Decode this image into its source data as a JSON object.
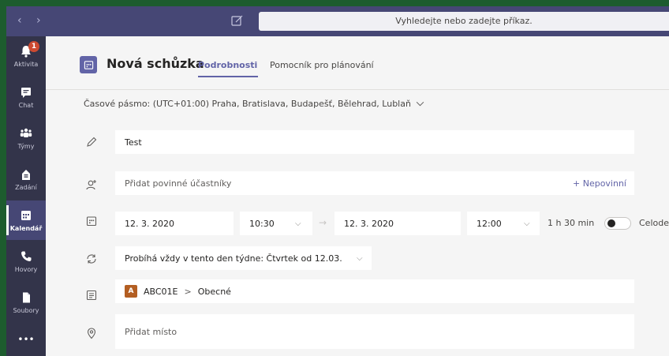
{
  "topbar": {
    "back_glyph": "‹",
    "forward_glyph": "›",
    "search_placeholder": "Vyhledejte nebo zadejte příkaz."
  },
  "rail": {
    "badge_count": "1",
    "items": [
      {
        "label": "Aktivita",
        "icon": "bell-icon"
      },
      {
        "label": "Chat",
        "icon": "chat-icon"
      },
      {
        "label": "Týmy",
        "icon": "teams-icon"
      },
      {
        "label": "Zadání",
        "icon": "assignments-icon"
      },
      {
        "label": "Kalendář",
        "icon": "calendar-icon"
      },
      {
        "label": "Hovory",
        "icon": "phone-icon"
      },
      {
        "label": "Soubory",
        "icon": "files-icon"
      }
    ],
    "more": "•••"
  },
  "header": {
    "title": "Nová schůzka",
    "tabs": [
      "Podrobnosti",
      "Pomocník pro plánování"
    ]
  },
  "timezone": "Časové pásmo: (UTC+01:00) Praha, Bratislava, Budapešť, Bělehrad, Lublaň",
  "form": {
    "title_value": "Test",
    "attendees_placeholder": "Přidat povinné účastníky",
    "optional_label": "+ Nepovinní",
    "start_date": "12. 3. 2020",
    "start_time": "10:30",
    "arrow": "→",
    "end_date": "12. 3. 2020",
    "end_time": "12:00",
    "duration": "1 h 30 min",
    "all_day_label": "Celodenní",
    "recurrence": "Probíhá vždy v tento den týdne: Čtvrtek od 12.03.",
    "channel_avatar": "A",
    "channel_team": "ABC01E",
    "channel_sep": ">",
    "channel_name": "Obecné",
    "location_placeholder": "Přidat místo"
  },
  "colors": {
    "accent": "#6264a7",
    "topbar": "#464775",
    "rail": "#33344a",
    "badge": "#cc4a31"
  }
}
